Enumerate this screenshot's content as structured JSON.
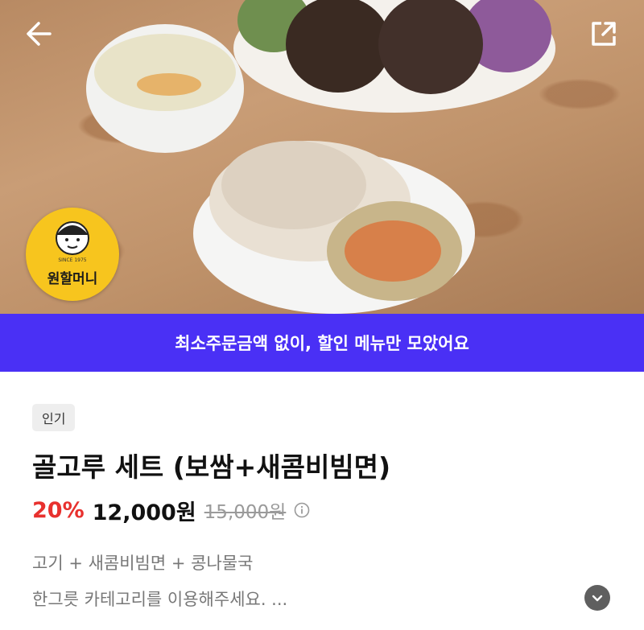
{
  "hero": {
    "logo_text": "원할머니",
    "logo_since": "SINCE 1975"
  },
  "icons": {
    "back": "arrow-left-icon",
    "share": "share-icon",
    "info": "info-icon",
    "more": "chevron-down-icon"
  },
  "banner": {
    "text": "최소주문금액 없이, 할인 메뉴만 모았어요"
  },
  "product": {
    "badge": "인기",
    "title": "골고루 세트 (보쌈+새콤비빔면)",
    "discount": "20%",
    "price": "12,000원",
    "original_price": "15,000원",
    "description_line1": "고기 + 새콤비빔면 + 콩나물국",
    "description_line2": "한그릇 카테고리를 이용해주세요. ..."
  },
  "colors": {
    "banner": "#4a30f5",
    "discount": "#e8312e",
    "logo": "#f7c51e"
  }
}
